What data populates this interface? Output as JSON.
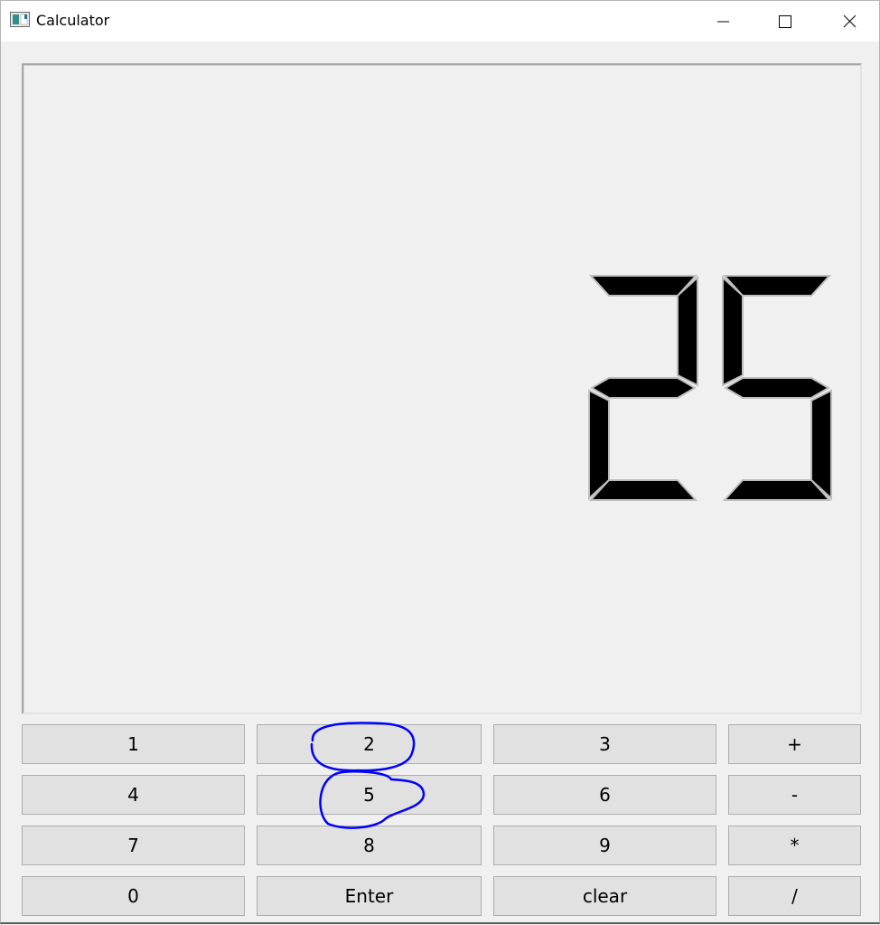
{
  "window": {
    "title": "Calculator",
    "icon": "app-window-icon",
    "controls": [
      "minimize-icon",
      "maximize-icon",
      "close-icon"
    ]
  },
  "display": {
    "value": "25"
  },
  "keypad": {
    "rows": [
      [
        "1",
        "2",
        "3",
        "+"
      ],
      [
        "4",
        "5",
        "6",
        "-"
      ],
      [
        "7",
        "8",
        "9",
        "*"
      ],
      [
        "0",
        "Enter",
        "clear",
        "/"
      ]
    ]
  },
  "annotations": {
    "color": "#0000ff",
    "circled_keys": [
      "2",
      "5"
    ]
  }
}
